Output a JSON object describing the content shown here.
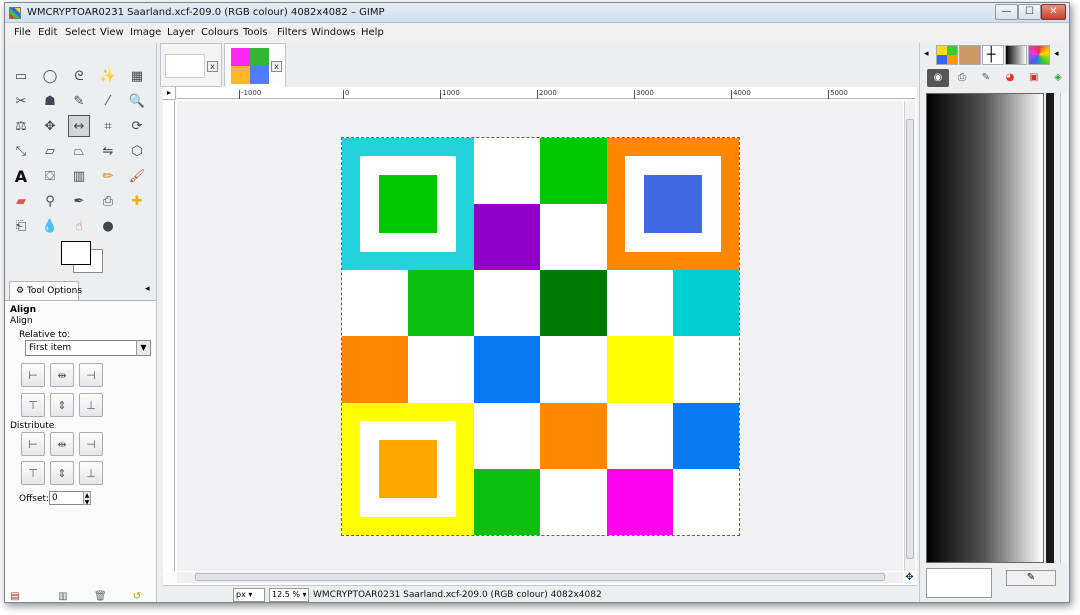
{
  "window": {
    "title": "WMCRYPTOAR0231 Saarland.xcf-209.0 (RGB colour) 4082x4082 – GIMP",
    "minimize": "—",
    "maximize": "☐",
    "close": "✕"
  },
  "menu": [
    "File",
    "Edit",
    "Select",
    "View",
    "Image",
    "Layer",
    "Colours",
    "Tools",
    "Filters",
    "Windows",
    "Help"
  ],
  "toolbox": {
    "tool_options_tab": "Tool Options",
    "tool_options": {
      "heading": "Align",
      "subheading": "Align",
      "relative_to_label": "Relative to:",
      "relative_to_value": "First item",
      "distribute_label": "Distribute",
      "offset_label": "Offset:",
      "offset_value": "0"
    }
  },
  "image_tabs": {
    "tab1_close": "x",
    "tab2_close": "x"
  },
  "ruler": {
    "h_ticks": [
      "-1000",
      "0",
      "1000",
      "2000",
      "3000",
      "4000",
      "5000"
    ]
  },
  "canvas": {
    "colors": {
      "cyan": "#22d3dd",
      "green": "#00c800",
      "bright_green": "#0ec00e",
      "purple": "#9000c8",
      "orange": "#ff8800",
      "blue": "#4169e1",
      "dark_green": "#007a00",
      "teal": "#00cfd2",
      "sky_blue": "#0a78f0",
      "yellow": "#ffff00",
      "amber": "#ffa500",
      "magenta": "#ff00ee",
      "white": "#ffffff"
    }
  },
  "statusbar": {
    "unit": "px ▾",
    "zoom": "12.5 % ▾",
    "text": "WMCRYPTOAR0231 Saarland.xcf-209.0 (RGB colour) 4082x4082"
  }
}
